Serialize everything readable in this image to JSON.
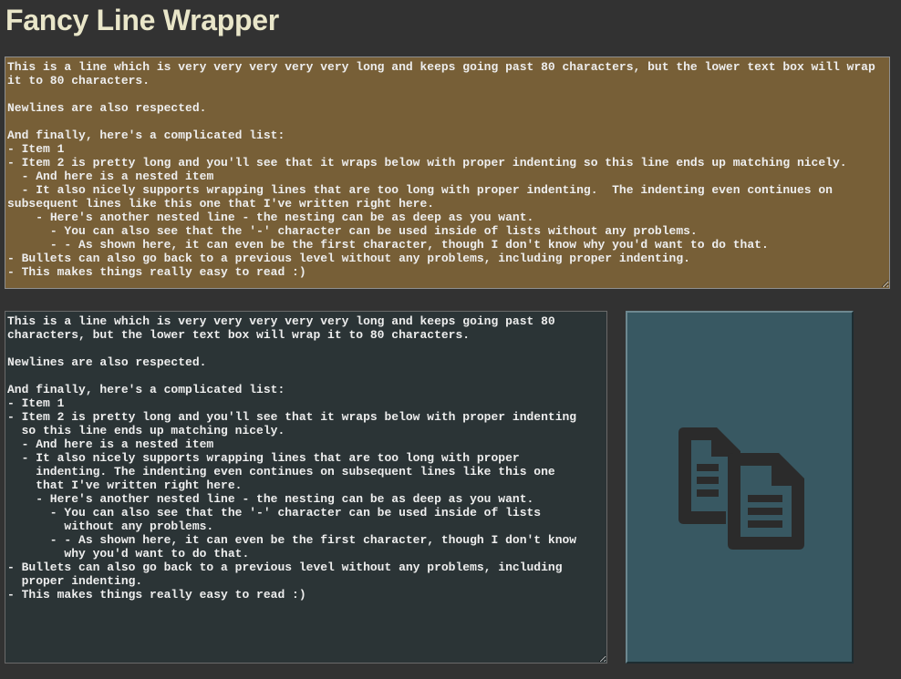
{
  "app": {
    "title": "Fancy Line Wrapper"
  },
  "input": {
    "value": "This is a line which is very very very very very long and keeps going past 80 characters, but the lower text box will wrap it to 80 characters.\n\nNewlines are also respected.\n\nAnd finally, here's a complicated list:\n- Item 1\n- Item 2 is pretty long and you'll see that it wraps below with proper indenting so this line ends up matching nicely.\n  - And here is a nested item\n  - It also nicely supports wrapping lines that are too long with proper indenting.  The indenting even continues on subsequent lines like this one that I've written right here.\n    - Here's another nested line - the nesting can be as deep as you want.\n      - You can also see that the '-' character can be used inside of lists without any problems.\n      - - As shown here, it can even be the first character, though I don't know why you'd want to do that.\n- Bullets can also go back to a previous level without any problems, including proper indenting.\n- This makes things really easy to read :)"
  },
  "output": {
    "value": "This is a line which is very very very very very long and keeps going past 80\ncharacters, but the lower text box will wrap it to 80 characters.\n\nNewlines are also respected.\n\nAnd finally, here's a complicated list:\n- Item 1\n- Item 2 is pretty long and you'll see that it wraps below with proper indenting\n  so this line ends up matching nicely.\n  - And here is a nested item\n  - It also nicely supports wrapping lines that are too long with proper\n    indenting. The indenting even continues on subsequent lines like this one\n    that I've written right here.\n    - Here's another nested line - the nesting can be as deep as you want.\n      - You can also see that the '-' character can be used inside of lists\n        without any problems.\n      - - As shown here, it can even be the first character, though I don't know\n        why you'd want to do that.\n- Bullets can also go back to a previous level without any problems, including\n  proper indenting.\n- This makes things really easy to read :)"
  },
  "copy_button": {
    "icon": "copy-documents-icon",
    "color_background": "#385862",
    "color_icon": "#2b2b2b"
  },
  "colors": {
    "page_background": "#323232",
    "title": "#e9e6c9",
    "input_background": "#775f37",
    "output_background": "#2b3436",
    "text": "#eeeeee"
  }
}
